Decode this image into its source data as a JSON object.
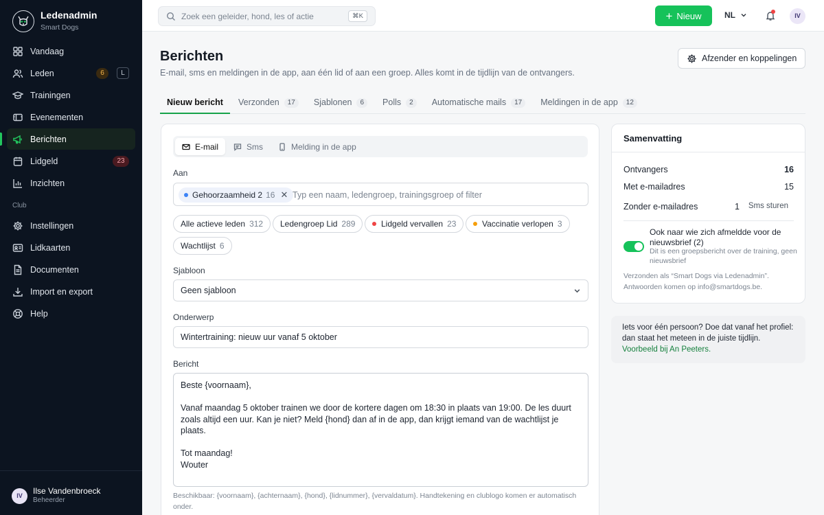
{
  "sidebar": {
    "brand_title": "Ledenadmin",
    "brand_sub": "Smart Dogs",
    "items": [
      {
        "label": "Vandaag",
        "icon": "grid-icon"
      },
      {
        "label": "Leden",
        "icon": "users-icon",
        "badge": "6",
        "key": "L"
      },
      {
        "label": "Trainingen",
        "icon": "graduation-cap-icon"
      },
      {
        "label": "Evenementen",
        "icon": "ticket-icon"
      },
      {
        "label": "Berichten",
        "icon": "megaphone-icon",
        "active": true
      },
      {
        "label": "Lidgeld",
        "icon": "calendar-icon",
        "badge": "23"
      },
      {
        "label": "Inzichten",
        "icon": "bar-chart-icon"
      }
    ],
    "section_label": "Club",
    "club_items": [
      {
        "label": "Instellingen",
        "icon": "gear-icon"
      },
      {
        "label": "Lidkaarten",
        "icon": "id-card-icon"
      },
      {
        "label": "Documenten",
        "icon": "document-icon"
      },
      {
        "label": "Import en export",
        "icon": "download-icon"
      },
      {
        "label": "Help",
        "icon": "help-icon"
      }
    ],
    "user": {
      "initials": "IV",
      "name": "Ilse Vandenbroeck",
      "role": "Beheerder"
    }
  },
  "topbar": {
    "search_placeholder": "Zoek een geleider, hond, les of actie",
    "search_shortcut": "⌘K",
    "new_label": "Nieuw",
    "lang": "NL",
    "avatar": "IV"
  },
  "header": {
    "title": "Berichten",
    "description": "E-mail, sms en meldingen in de app, aan één lid of aan een groep. Alles komt in de tijdlijn van de ontvangers.",
    "sender_button": "Afzender en koppelingen"
  },
  "tabs": [
    {
      "label": "Nieuw bericht",
      "count": ""
    },
    {
      "label": "Verzonden",
      "count": "17"
    },
    {
      "label": "Sjablonen",
      "count": "6"
    },
    {
      "label": "Polls",
      "count": "2"
    },
    {
      "label": "Automatische mails",
      "count": "17"
    },
    {
      "label": "Meldingen in de app",
      "count": "12"
    }
  ],
  "composer": {
    "channels": [
      "E-mail",
      "Sms",
      "Melding in de app"
    ],
    "to_label": "Aan",
    "recipient_chip": {
      "label": "Gehoorzaamheid 2",
      "count": "16"
    },
    "to_placeholder": "Typ een naam, ledengroep, trainingsgroep of filter",
    "groups": [
      {
        "label": "Alle actieve leden",
        "count": "312",
        "dot": ""
      },
      {
        "label": "Ledengroep Lid",
        "count": "289",
        "dot": ""
      },
      {
        "label": "Lidgeld vervallen",
        "count": "23",
        "dot": "#ef4444"
      },
      {
        "label": "Vaccinatie verlopen",
        "count": "3",
        "dot": "#f59e0b"
      },
      {
        "label": "Wachtlijst",
        "count": "6",
        "dot": ""
      }
    ],
    "template_label": "Sjabloon",
    "template_value": "Geen sjabloon",
    "subject_label": "Onderwerp",
    "subject_value": "Wintertraining: nieuw uur vanaf 5 oktober",
    "message_label": "Bericht",
    "message_value": "Beste {voornaam},\n\nVanaf maandag 5 oktober trainen we door de kortere dagen om 18:30 in plaats van 19:00. De les duurt zoals altijd een uur. Kan je niet? Meld {hond} dan af in de app, dan krijgt iemand van de wachtlijst je plaats.\n\nTot maandag!\nWouter",
    "helper": "Beschikbaar: {voornaam}, {achternaam}, {hond}, {lidnummer}, {vervaldatum}. Handtekening en clublogo komen er automatisch onder."
  },
  "summary": {
    "title": "Samenvatting",
    "recipients_label": "Ontvangers",
    "recipients_value": "16",
    "with_email_label": "Met e-mailadres",
    "with_email_value": "15",
    "without_email_label": "Zonder e-mailadres",
    "without_email_value": "1",
    "sms_label": "Sms sturen",
    "toggle_label": "Ook naar wie zich afmeldde voor de nieuwsbrief (2)",
    "toggle_sub": "Dit is een groepsbericht over de training, geen nieuwsbrief",
    "footer": "Verzonden als “Smart Dogs via Ledenadmin”. Antwoorden komen op info@smartdogs.be."
  },
  "tip": {
    "text": "Iets voor één persoon? Doe dat vanaf het profiel: dan staat het meteen in de juiste tijdlijn.",
    "link": "Voorbeeld bij An Peeters."
  },
  "colors": {
    "accent": "#16c25a",
    "sidebar_bg": "#0c1420",
    "danger": "#ef4444",
    "warning": "#f59e0b"
  }
}
